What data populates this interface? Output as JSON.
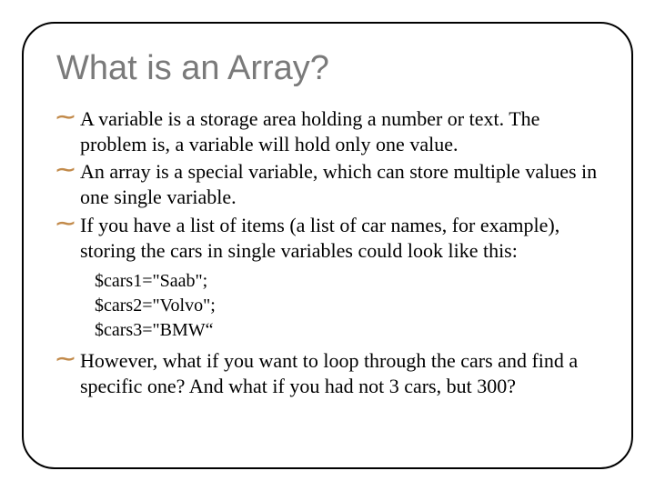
{
  "title": "What is an Array?",
  "items": {
    "i0": "A variable is a storage area holding a number or text. The problem is, a variable will hold only one value.",
    "i1": "An array is a special variable, which can store multiple values in one single variable.",
    "i2": "If you have a list of items (a list of car names, for example), storing the cars in single variables could look like this:",
    "i3": "However, what if you want to loop through the cars and find a specific one? And what if you had not 3 cars, but 300?"
  },
  "code": {
    "l0": "$cars1=\"Saab\";",
    "l1": "$cars2=\"Volvo\";",
    "l2": "$cars3=\"BMW“"
  },
  "bullet_glyph": "་"
}
